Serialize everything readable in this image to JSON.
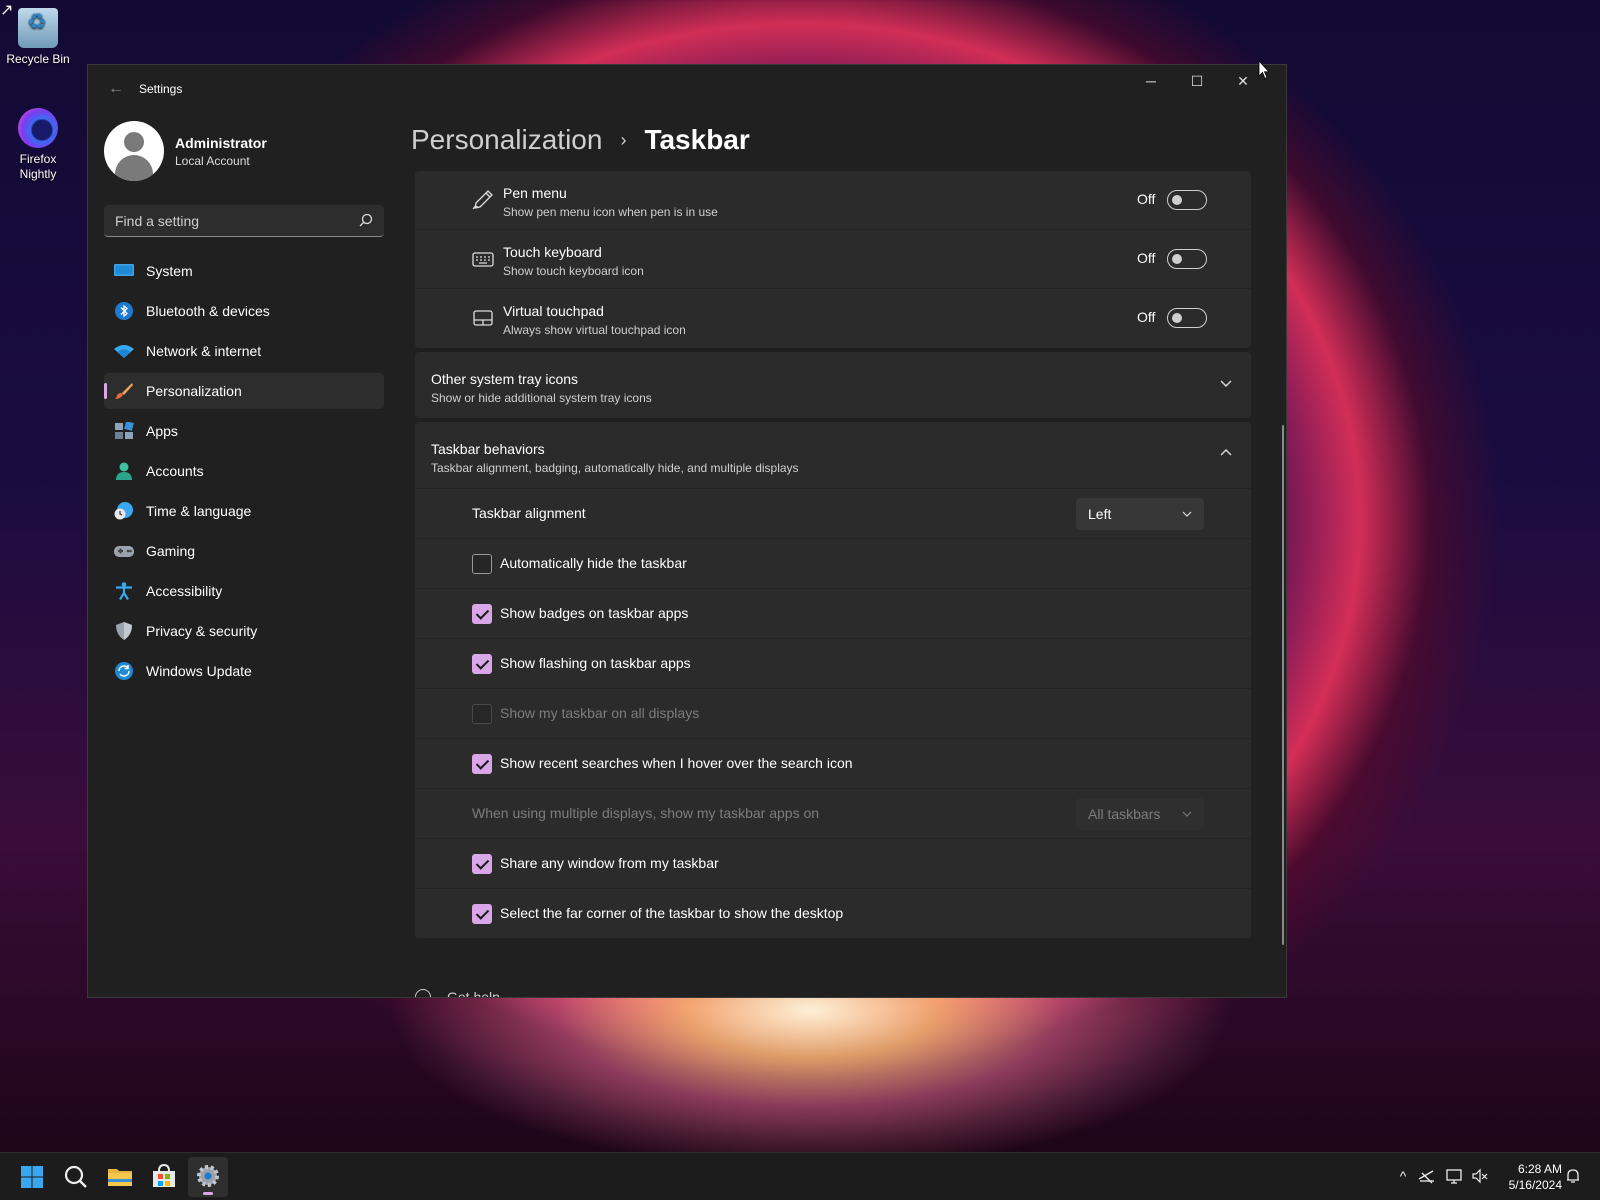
{
  "desktop": {
    "icons": [
      {
        "label": "Recycle Bin"
      },
      {
        "label": "Firefox Nightly"
      }
    ]
  },
  "window": {
    "title": "Settings",
    "controls": {
      "minimize": "─",
      "maximize": "☐",
      "close": "✕"
    }
  },
  "profile": {
    "name": "Administrator",
    "account": "Local Account"
  },
  "search": {
    "placeholder": "Find a setting"
  },
  "nav": {
    "items": [
      {
        "label": "System",
        "icon": "system-icon"
      },
      {
        "label": "Bluetooth & devices",
        "icon": "bluetooth-icon"
      },
      {
        "label": "Network & internet",
        "icon": "wifi-icon"
      },
      {
        "label": "Personalization",
        "icon": "brush-icon",
        "active": true
      },
      {
        "label": "Apps",
        "icon": "apps-icon"
      },
      {
        "label": "Accounts",
        "icon": "accounts-icon"
      },
      {
        "label": "Time & language",
        "icon": "clock-globe-icon"
      },
      {
        "label": "Gaming",
        "icon": "gamepad-icon"
      },
      {
        "label": "Accessibility",
        "icon": "accessibility-icon"
      },
      {
        "label": "Privacy & security",
        "icon": "shield-icon"
      },
      {
        "label": "Windows Update",
        "icon": "update-icon"
      }
    ]
  },
  "breadcrumb": {
    "parent": "Personalization",
    "separator": "›",
    "current": "Taskbar"
  },
  "tray_toggles": [
    {
      "title": "Pen menu",
      "desc": "Show pen menu icon when pen is in use",
      "state": "Off",
      "icon": "pen-icon"
    },
    {
      "title": "Touch keyboard",
      "desc": "Show touch keyboard icon",
      "state": "Off",
      "icon": "keyboard-icon"
    },
    {
      "title": "Virtual touchpad",
      "desc": "Always show virtual touchpad icon",
      "state": "Off",
      "icon": "touchpad-icon"
    }
  ],
  "other_tray": {
    "title": "Other system tray icons",
    "desc": "Show or hide additional system tray icons"
  },
  "behaviors": {
    "title": "Taskbar behaviors",
    "desc": "Taskbar alignment, badging, automatically hide, and multiple displays",
    "alignment_label": "Taskbar alignment",
    "alignment_value": "Left",
    "checks": [
      {
        "label": "Automatically hide the taskbar",
        "checked": false
      },
      {
        "label": "Show badges on taskbar apps",
        "checked": true
      },
      {
        "label": "Show flashing on taskbar apps",
        "checked": true
      },
      {
        "label": "Show my taskbar on all displays",
        "checked": false,
        "disabled": true
      },
      {
        "label": "Show recent searches when I hover over the search icon",
        "checked": true
      }
    ],
    "multi_label": "When using multiple displays, show my taskbar apps on",
    "multi_value": "All taskbars",
    "checks2": [
      {
        "label": "Share any window from my taskbar",
        "checked": true
      },
      {
        "label": "Select the far corner of the taskbar to show the desktop",
        "checked": true
      }
    ]
  },
  "get_help": "Get help",
  "taskbar": {
    "time": "6:28 AM",
    "date": "5/16/2024",
    "apps": [
      "start-icon",
      "search-icon",
      "file-explorer-icon",
      "store-icon",
      "settings-icon"
    ]
  },
  "colors": {
    "accent": "#d9a6e8",
    "window_bg": "#202020",
    "card_bg": "#2b2b2b"
  }
}
